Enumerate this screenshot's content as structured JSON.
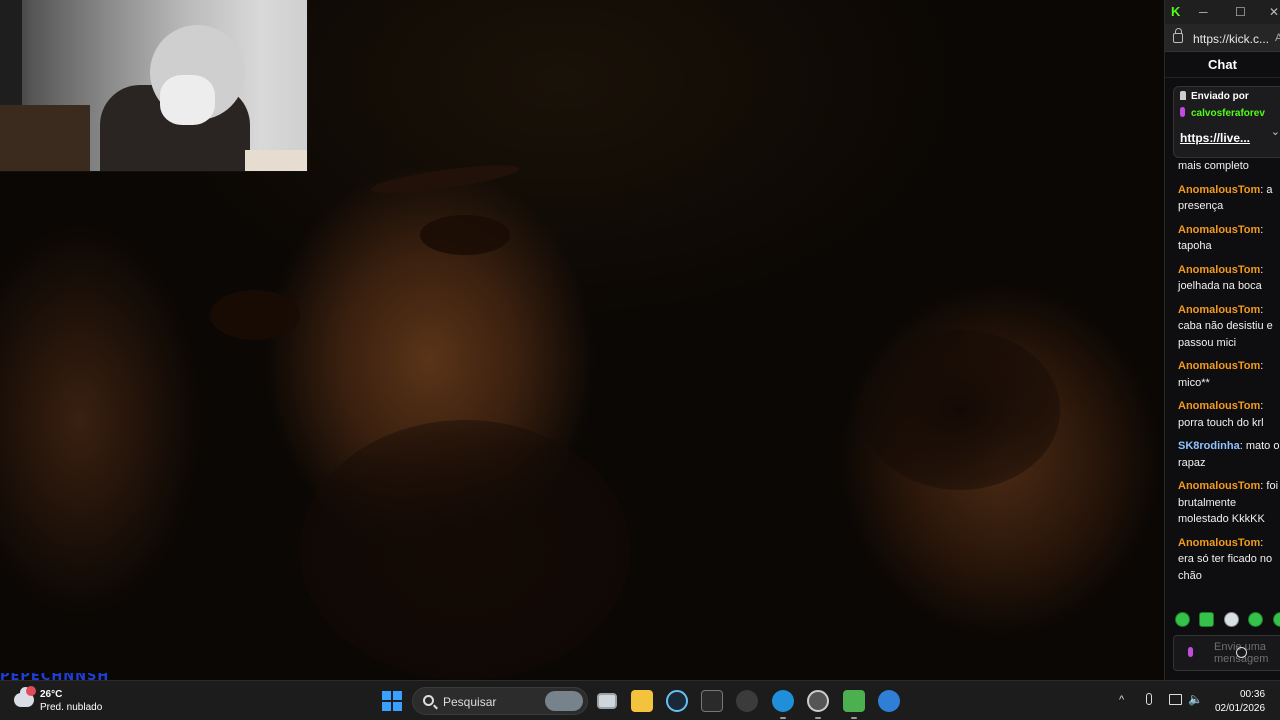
{
  "artifact_text": "PEPECHNNSH",
  "browser": {
    "url": "https://kick.c...",
    "url_extra": "A",
    "titlebar_buttons": [
      "─",
      "☐",
      "✕"
    ],
    "chat_title": "Chat",
    "pinned": {
      "label": "Enviado por",
      "user": "calvosferaforev",
      "link": "https://live..."
    },
    "messages": [
      {
        "user": "",
        "text": "mais completo",
        "color": "orange"
      },
      {
        "user": "AnomalousTom",
        "text": ": a presença",
        "color": "orange"
      },
      {
        "user": "AnomalousTom",
        "text": ": tapoha",
        "color": "orange"
      },
      {
        "user": "AnomalousTom",
        "text": ": joelhada na boca",
        "color": "orange"
      },
      {
        "user": "AnomalousTom",
        "text": ": caba não desistiu e passou mici",
        "color": "orange"
      },
      {
        "user": "AnomalousTom",
        "text": ": mico**",
        "color": "orange"
      },
      {
        "user": "AnomalousTom",
        "text": ": porra touch do krl",
        "color": "orange"
      },
      {
        "user": "SK8rodinha",
        "text": ": mato o rapaz",
        "color": "blue"
      },
      {
        "user": "AnomalousTom",
        "text": ": foi brutalmente molestado KkkKK",
        "color": "orange"
      },
      {
        "user": "AnomalousTom",
        "text": ": era só ter ficado no chão",
        "color": "orange"
      }
    ],
    "input_placeholder": "Envie uma mensagem"
  },
  "taskbar": {
    "weather_temp": "26°C",
    "weather_desc": "Pred. nublado",
    "search_label": "Pesquisar",
    "time": "00:36",
    "date": "02/01/2026"
  },
  "colors": {
    "kick_green": "#53fc18",
    "username_orange": "#f29a1e",
    "username_blue": "#8fc3ff",
    "windows_blue": "#3aa0ff"
  }
}
